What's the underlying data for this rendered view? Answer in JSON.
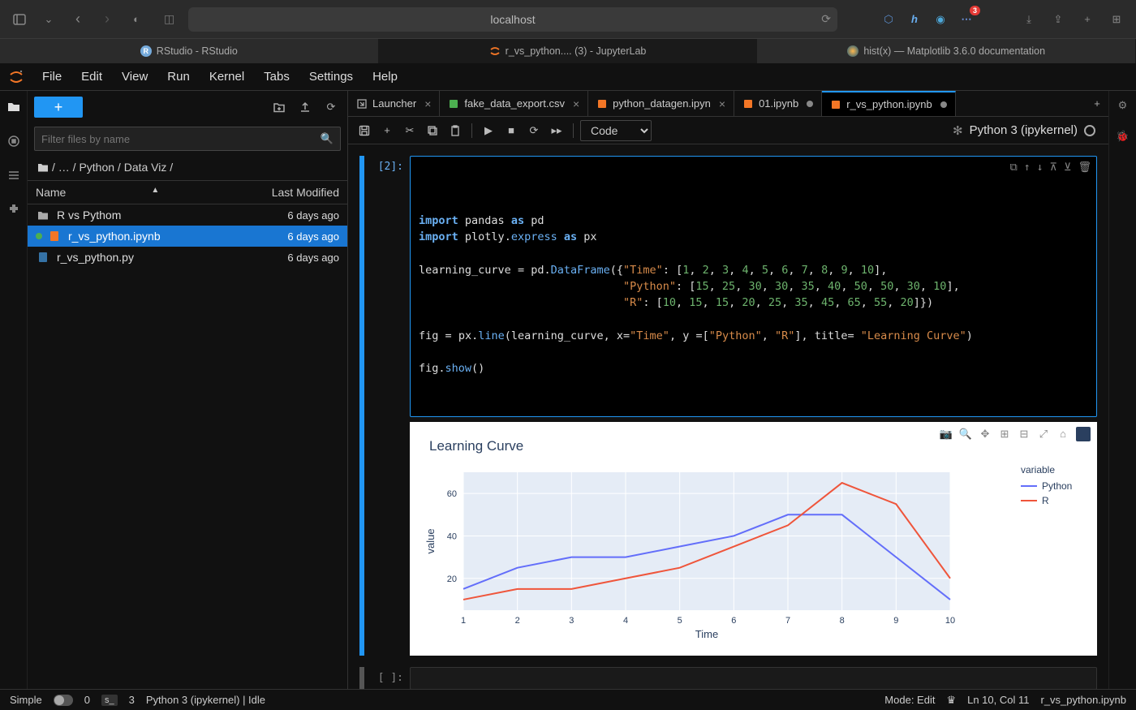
{
  "browser": {
    "url": "localhost",
    "badge_count": "3",
    "tabs": [
      {
        "label": "RStudio - RStudio",
        "icon_color": "#75aadb"
      },
      {
        "label": "r_vs_python.... (3) - JupyterLab",
        "icon_color": "#f37626",
        "active": true
      },
      {
        "label": "hist(x) — Matplotlib 3.6.0 documentation",
        "icon_color": "#11557c"
      }
    ]
  },
  "menu": [
    "File",
    "Edit",
    "View",
    "Run",
    "Kernel",
    "Tabs",
    "Settings",
    "Help"
  ],
  "sidebar": {
    "filter_placeholder": "Filter files by name",
    "breadcrumb": [
      "",
      "…",
      "Python",
      "Data Viz",
      ""
    ],
    "columns": {
      "name": "Name",
      "modified": "Last Modified"
    },
    "files": [
      {
        "type": "folder",
        "name": "R vs Pythom",
        "modified": "6 days ago"
      },
      {
        "type": "notebook",
        "name": "r_vs_python.ipynb",
        "modified": "6 days ago",
        "selected": true,
        "running": true
      },
      {
        "type": "python",
        "name": "r_vs_python.py",
        "modified": "6 days ago"
      }
    ]
  },
  "notebook_tabs": [
    {
      "label": "Launcher",
      "icon": "launcher",
      "close": true
    },
    {
      "label": "fake_data_export.csv",
      "icon": "csv",
      "close": true
    },
    {
      "label": "python_datagen.ipyn",
      "icon": "notebook",
      "close": true
    },
    {
      "label": "01.ipynb",
      "icon": "notebook",
      "dirty": true
    },
    {
      "label": "r_vs_python.ipynb",
      "icon": "notebook",
      "active": true,
      "dirty": true
    }
  ],
  "toolbar": {
    "celltype": "Code",
    "kernel": "Python 3 (ipykernel)"
  },
  "cell": {
    "prompt": "[2]:",
    "code_lines": [
      [
        {
          "t": "kw",
          "v": "import"
        },
        {
          "t": "sp",
          "v": " "
        },
        {
          "t": "id",
          "v": "pandas"
        },
        {
          "t": "sp",
          "v": " "
        },
        {
          "t": "kw",
          "v": "as"
        },
        {
          "t": "sp",
          "v": " "
        },
        {
          "t": "id",
          "v": "pd"
        }
      ],
      [
        {
          "t": "kw",
          "v": "import"
        },
        {
          "t": "sp",
          "v": " "
        },
        {
          "t": "id",
          "v": "plotly"
        },
        {
          "t": "op",
          "v": "."
        },
        {
          "t": "fn",
          "v": "express"
        },
        {
          "t": "sp",
          "v": " "
        },
        {
          "t": "kw",
          "v": "as"
        },
        {
          "t": "sp",
          "v": " "
        },
        {
          "t": "id",
          "v": "px"
        }
      ],
      [],
      [
        {
          "t": "id",
          "v": "learning_curve"
        },
        {
          "t": "sp",
          "v": " "
        },
        {
          "t": "op",
          "v": "="
        },
        {
          "t": "sp",
          "v": " "
        },
        {
          "t": "id",
          "v": "pd"
        },
        {
          "t": "op",
          "v": "."
        },
        {
          "t": "fn",
          "v": "DataFrame"
        },
        {
          "t": "op",
          "v": "({"
        },
        {
          "t": "str",
          "v": "\"Time\""
        },
        {
          "t": "op",
          "v": ": ["
        },
        {
          "t": "num",
          "v": "1"
        },
        {
          "t": "op",
          "v": ", "
        },
        {
          "t": "num",
          "v": "2"
        },
        {
          "t": "op",
          "v": ", "
        },
        {
          "t": "num",
          "v": "3"
        },
        {
          "t": "op",
          "v": ", "
        },
        {
          "t": "num",
          "v": "4"
        },
        {
          "t": "op",
          "v": ", "
        },
        {
          "t": "num",
          "v": "5"
        },
        {
          "t": "op",
          "v": ", "
        },
        {
          "t": "num",
          "v": "6"
        },
        {
          "t": "op",
          "v": ", "
        },
        {
          "t": "num",
          "v": "7"
        },
        {
          "t": "op",
          "v": ", "
        },
        {
          "t": "num",
          "v": "8"
        },
        {
          "t": "op",
          "v": ", "
        },
        {
          "t": "num",
          "v": "9"
        },
        {
          "t": "op",
          "v": ", "
        },
        {
          "t": "num",
          "v": "10"
        },
        {
          "t": "op",
          "v": "],"
        }
      ],
      [
        {
          "t": "sp",
          "v": "                               "
        },
        {
          "t": "str",
          "v": "\"Python\""
        },
        {
          "t": "op",
          "v": ": ["
        },
        {
          "t": "num",
          "v": "15"
        },
        {
          "t": "op",
          "v": ", "
        },
        {
          "t": "num",
          "v": "25"
        },
        {
          "t": "op",
          "v": ", "
        },
        {
          "t": "num",
          "v": "30"
        },
        {
          "t": "op",
          "v": ", "
        },
        {
          "t": "num",
          "v": "30"
        },
        {
          "t": "op",
          "v": ", "
        },
        {
          "t": "num",
          "v": "35"
        },
        {
          "t": "op",
          "v": ", "
        },
        {
          "t": "num",
          "v": "40"
        },
        {
          "t": "op",
          "v": ", "
        },
        {
          "t": "num",
          "v": "50"
        },
        {
          "t": "op",
          "v": ", "
        },
        {
          "t": "num",
          "v": "50"
        },
        {
          "t": "op",
          "v": ", "
        },
        {
          "t": "num",
          "v": "30"
        },
        {
          "t": "op",
          "v": ", "
        },
        {
          "t": "num",
          "v": "10"
        },
        {
          "t": "op",
          "v": "],"
        }
      ],
      [
        {
          "t": "sp",
          "v": "                               "
        },
        {
          "t": "str",
          "v": "\"R\""
        },
        {
          "t": "op",
          "v": ": ["
        },
        {
          "t": "num",
          "v": "10"
        },
        {
          "t": "op",
          "v": ", "
        },
        {
          "t": "num",
          "v": "15"
        },
        {
          "t": "op",
          "v": ", "
        },
        {
          "t": "num",
          "v": "15"
        },
        {
          "t": "op",
          "v": ", "
        },
        {
          "t": "num",
          "v": "20"
        },
        {
          "t": "op",
          "v": ", "
        },
        {
          "t": "num",
          "v": "25"
        },
        {
          "t": "op",
          "v": ", "
        },
        {
          "t": "num",
          "v": "35"
        },
        {
          "t": "op",
          "v": ", "
        },
        {
          "t": "num",
          "v": "45"
        },
        {
          "t": "op",
          "v": ", "
        },
        {
          "t": "num",
          "v": "65"
        },
        {
          "t": "op",
          "v": ", "
        },
        {
          "t": "num",
          "v": "55"
        },
        {
          "t": "op",
          "v": ", "
        },
        {
          "t": "num",
          "v": "20"
        },
        {
          "t": "op",
          "v": "]})"
        }
      ],
      [],
      [
        {
          "t": "id",
          "v": "fig"
        },
        {
          "t": "sp",
          "v": " "
        },
        {
          "t": "op",
          "v": "="
        },
        {
          "t": "sp",
          "v": " "
        },
        {
          "t": "id",
          "v": "px"
        },
        {
          "t": "op",
          "v": "."
        },
        {
          "t": "fn",
          "v": "line"
        },
        {
          "t": "op",
          "v": "(learning_curve, x="
        },
        {
          "t": "str",
          "v": "\"Time\""
        },
        {
          "t": "op",
          "v": ", y =["
        },
        {
          "t": "str",
          "v": "\"Python\""
        },
        {
          "t": "op",
          "v": ", "
        },
        {
          "t": "str",
          "v": "\"R\""
        },
        {
          "t": "op",
          "v": "], title= "
        },
        {
          "t": "str",
          "v": "\"Learning Curve\""
        },
        {
          "t": "op",
          "v": ")"
        }
      ],
      [],
      [
        {
          "t": "id",
          "v": "fig"
        },
        {
          "t": "op",
          "v": "."
        },
        {
          "t": "fn",
          "v": "show"
        },
        {
          "t": "op",
          "v": "()"
        }
      ]
    ]
  },
  "empty_prompt": "[ ]:",
  "chart_data": {
    "type": "line",
    "title": "Learning Curve",
    "xlabel": "Time",
    "ylabel": "value",
    "legend_title": "variable",
    "x": [
      1,
      2,
      3,
      4,
      5,
      6,
      7,
      8,
      9,
      10
    ],
    "series": [
      {
        "name": "Python",
        "color": "#636efa",
        "values": [
          15,
          25,
          30,
          30,
          35,
          40,
          50,
          50,
          30,
          10
        ]
      },
      {
        "name": "R",
        "color": "#ef553b",
        "values": [
          10,
          15,
          15,
          20,
          25,
          35,
          45,
          65,
          55,
          20
        ]
      }
    ],
    "yticks": [
      20,
      40,
      60
    ],
    "xlim": [
      1,
      10
    ],
    "ylim": [
      5,
      70
    ]
  },
  "status": {
    "simple": "Simple",
    "count0": "0",
    "term": "s_",
    "count3": "3",
    "sep": "",
    "kernel": "Python 3 (ipykernel) | Idle",
    "mode": "Mode: Edit",
    "ln": "Ln 10, Col 11",
    "file": "r_vs_python.ipynb"
  }
}
